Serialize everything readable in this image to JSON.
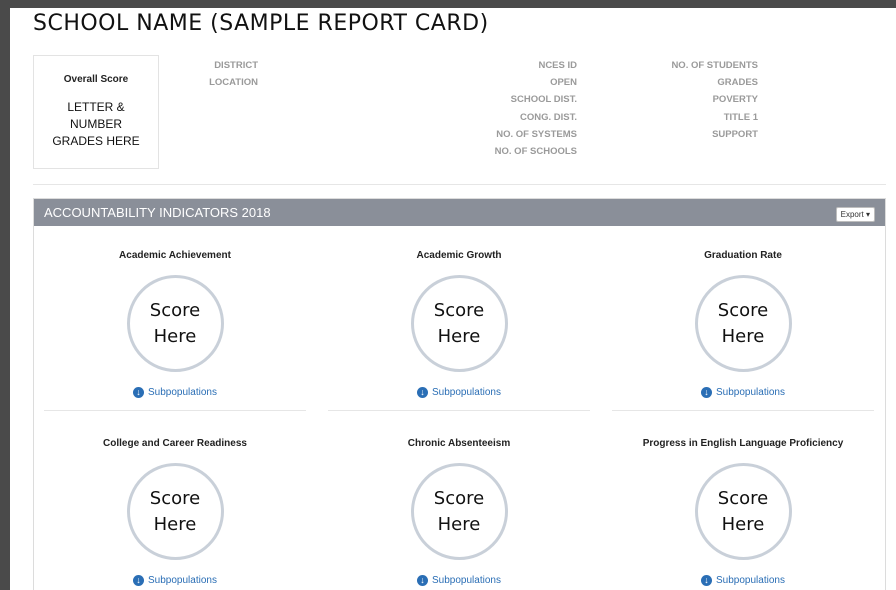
{
  "header": {
    "title": "SCHOOL NAME (SAMPLE REPORT CARD)"
  },
  "overall": {
    "label": "Overall Score",
    "value": "LETTER & NUMBER GRADES HERE"
  },
  "info": {
    "col1": [
      "DISTRICT",
      "LOCATION"
    ],
    "col2": [
      "NCES ID",
      "OPEN",
      "SCHOOL DIST.",
      "CONG. DIST.",
      "NO. OF SYSTEMS",
      "NO. OF SCHOOLS"
    ],
    "col3": [
      "NO. OF STUDENTS",
      "GRADES",
      "POVERTY",
      "TITLE 1",
      "SUPPORT"
    ]
  },
  "panel": {
    "title": "ACCOUNTABILITY INDICATORS 2018",
    "export_label": "Export ▾",
    "score_text": "Score Here",
    "subpop_label": "Subpopulations",
    "indicators": [
      "Academic Achievement",
      "Academic Growth",
      "Graduation Rate",
      "College and Career Readiness",
      "Chronic Absenteeism",
      "Progress in English Language Proficiency"
    ]
  },
  "colors": {
    "accent": "#2a6eb5",
    "panel_header": "#8a8f99",
    "circle_border": "#c9d0d9"
  },
  "icons": {
    "subpopulations": "arrow-down-circle-icon"
  }
}
